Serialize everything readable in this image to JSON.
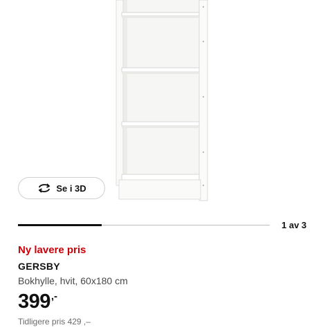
{
  "gallery": {
    "view3d_label": "Se i 3D",
    "view3d_icon": "rotate-3d-icon",
    "counter": "1 av 3",
    "progress_fraction": 0.333
  },
  "product": {
    "promo": "Ny lavere pris",
    "name": "GERSBY",
    "description": "Bokhylle, hvit, 60x180 cm",
    "price_amount": "399",
    "price_suffix": ",-",
    "previous_price": "Tidligere pris 429 ,–"
  },
  "colors": {
    "promo_red": "#cc0008",
    "text_dark": "#111111",
    "text_muted": "#6b6b6b"
  }
}
